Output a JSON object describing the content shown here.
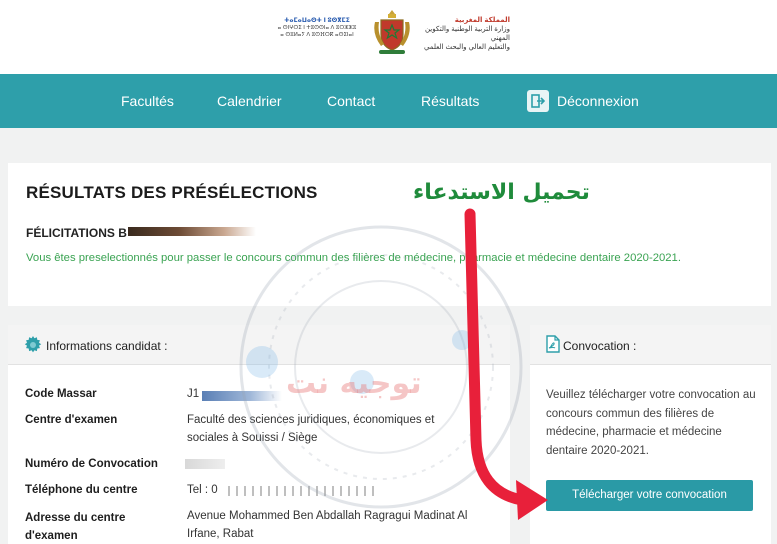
{
  "header": {
    "left_logo_line1": "ⵜⴰⵎⴰⵡⴰⵙⵜ ⵏ ⵓⵙⴳⵎⵉ",
    "left_logo_line2": "ⴰ ⵙⵏⵖⵔⵉ ⵏ ⵜⵓⵙⵙⵏⴰ ⴷ ⵓⵔⵣⵣⵓ",
    "left_logo_line3": "ⴰ ⵙⵓⵍⴰⵢ ⴷ ⵓⵙⴼⵔⴽ ⴰⵙⵉⵏⴰⵏ",
    "right_logo_line1": "المملكة المغربية",
    "right_logo_line2": "وزارة التربية الوطنية والتكوين المهني",
    "right_logo_line3": "والتعليم العالي والبحث العلمي"
  },
  "nav": {
    "items": [
      {
        "label": "Facultés"
      },
      {
        "label": "Calendrier"
      },
      {
        "label": "Contact"
      },
      {
        "label": "Résultats"
      },
      {
        "label": "Déconnexion"
      }
    ]
  },
  "results": {
    "title": "RÉSULTATS DES PRÉSÉLECTIONS",
    "felicitations": "FÉLICITATIONS B",
    "notice": "Vous êtes preselectionnés pour passer le concours commun des filières de médecine, pharmacie et médecine dentaire 2020-2021."
  },
  "candidate": {
    "header": "Informations candidat :",
    "rows": [
      {
        "label": "Code Massar",
        "value": "J1"
      },
      {
        "label": "Centre d'examen",
        "value": "Faculté des sciences juridiques, économiques et sociales à Souissi / Siège"
      },
      {
        "label": "Numéro de Convocation",
        "value": ""
      },
      {
        "label": "Téléphone du centre",
        "value": "Tel : 0"
      },
      {
        "label": "Adresse du centre d'examen",
        "value": "Avenue Mohammed Ben Abdallah Ragragui Madinat Al Irfane,  Rabat"
      }
    ]
  },
  "convocation": {
    "header": "Convocation :",
    "text": "Veuillez télécharger votre convocation au concours commun des filières de médecine, pharmacie et médecine dentaire 2020-2021.",
    "button": "Télécharger votre convocation"
  },
  "overlay": {
    "annotation": "تحميل الاستدعاء",
    "watermark": "توجيه نت"
  },
  "colors": {
    "nav_bg": "#2e9faa",
    "button_bg": "#2a9aa6",
    "notice_text": "#3aa352",
    "arrow": "#e8203a",
    "annotation": "#1f8b3b"
  }
}
